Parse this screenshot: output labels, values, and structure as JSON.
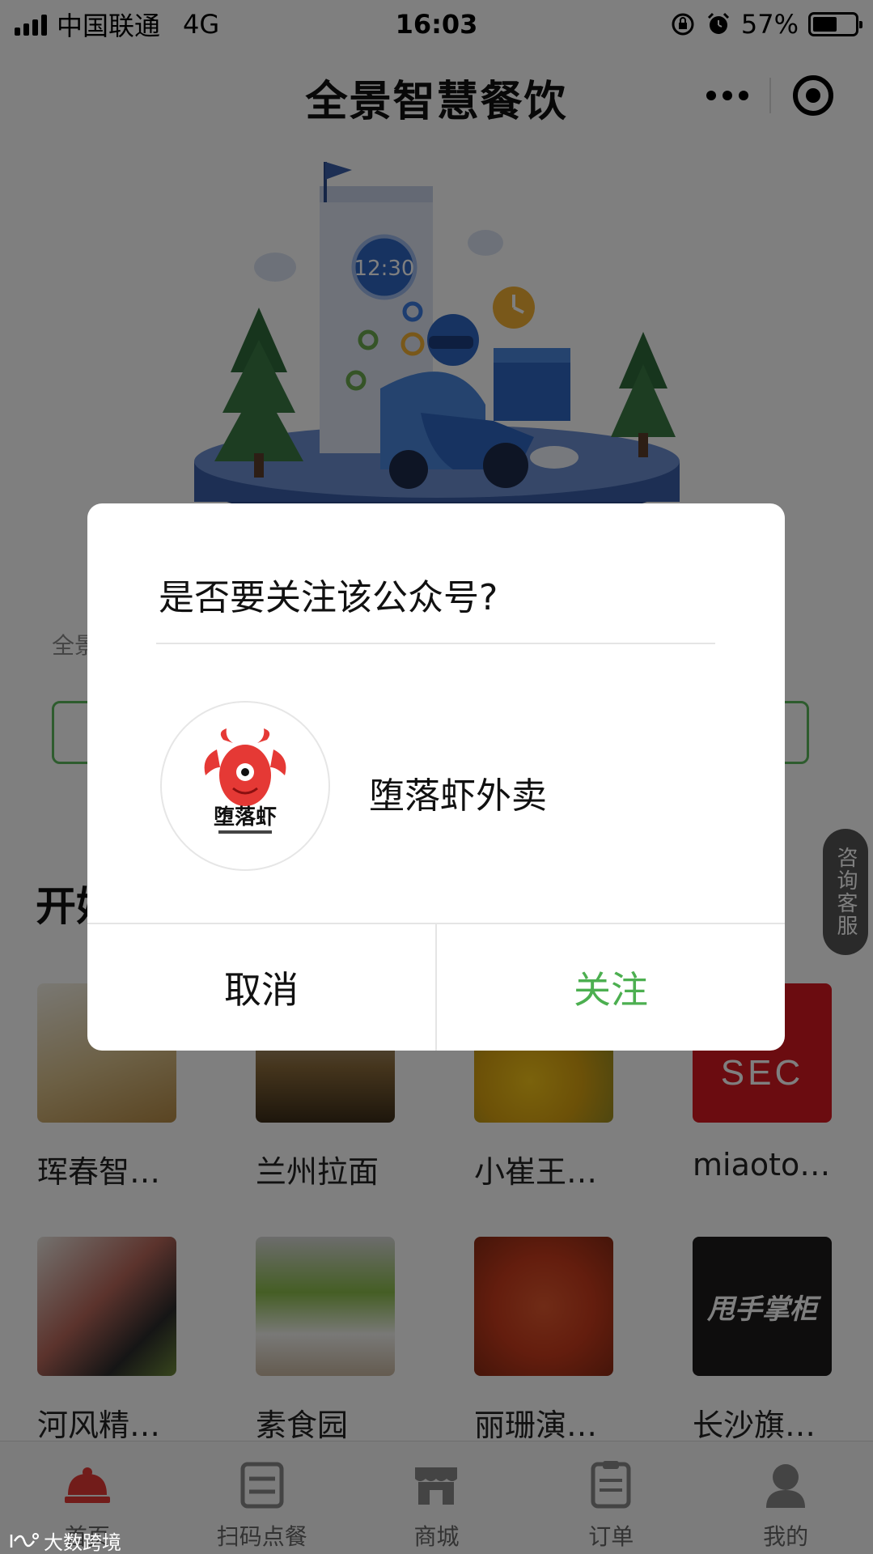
{
  "status_bar": {
    "carrier": "中国联通",
    "network": "4G",
    "time": "16:03",
    "battery": "57%",
    "battery_level": 0.57
  },
  "nav": {
    "title": "全景智慧餐饮"
  },
  "hero": {
    "clock_text": "12:30"
  },
  "page": {
    "intro_text": "全景",
    "section_title": "开始"
  },
  "consult": {
    "label": "咨询客服"
  },
  "grid": [
    [
      {
        "name": "珲春智…"
      },
      {
        "name": "兰州拉面"
      },
      {
        "name": "小崔王…"
      },
      {
        "name": "miaoto…"
      }
    ],
    [
      {
        "name": "河风精…"
      },
      {
        "name": "素食园"
      },
      {
        "name": "丽珊演…"
      },
      {
        "name": "长沙旗…"
      }
    ]
  ],
  "grid_thumb_text": {
    "sec": "SEC",
    "shuaishou": "甩手掌柜"
  },
  "tabs": [
    {
      "label": "首页",
      "icon": "home-icon"
    },
    {
      "label": "扫码点餐",
      "icon": "scan-order-icon"
    },
    {
      "label": "商城",
      "icon": "store-icon"
    },
    {
      "label": "订单",
      "icon": "order-icon"
    },
    {
      "label": "我的",
      "icon": "profile-icon"
    }
  ],
  "watermark": "大数跨境",
  "modal": {
    "title": "是否要关注该公众号?",
    "account_name": "堕落虾外卖",
    "account_logo_text": "堕落虾",
    "cancel_label": "取消",
    "follow_label": "关注"
  },
  "colors": {
    "accent_green": "#4caf50",
    "overlay": "rgba(0,0,0,0.5)"
  }
}
